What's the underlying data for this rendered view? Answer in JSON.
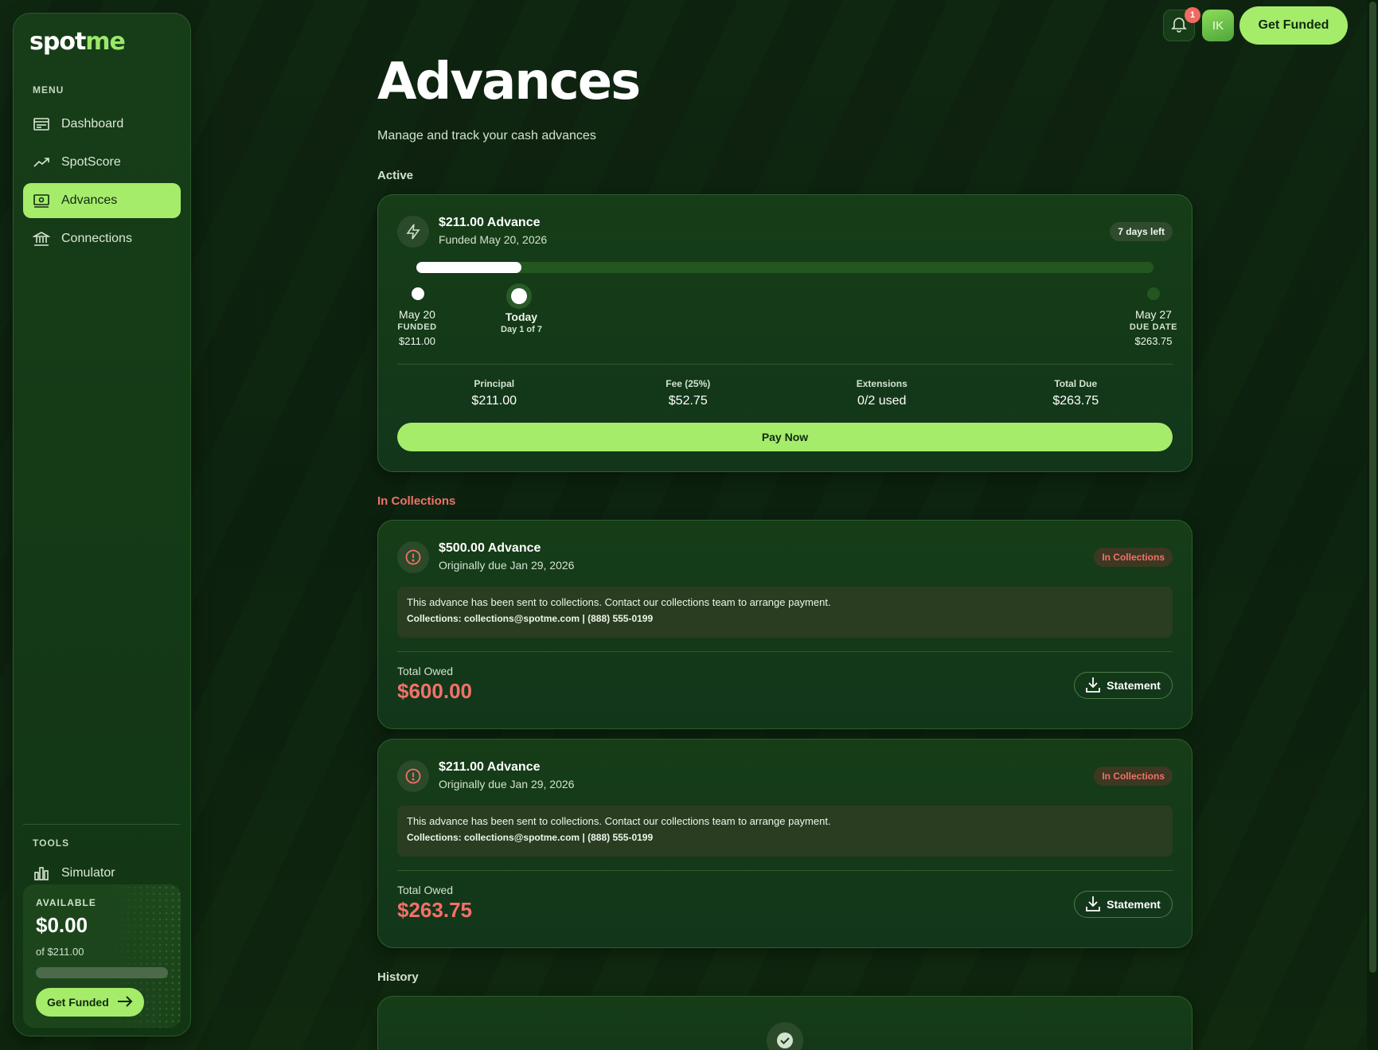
{
  "brand": {
    "logo_part1": "spot",
    "logo_part2": "me"
  },
  "sidebar": {
    "menu_label": "MENU",
    "items": [
      {
        "label": "Dashboard",
        "icon": "dashboard-icon"
      },
      {
        "label": "SpotScore",
        "icon": "trend-icon"
      },
      {
        "label": "Advances",
        "icon": "cash-icon",
        "active": true
      },
      {
        "label": "Connections",
        "icon": "bank-icon"
      }
    ],
    "tools_label": "TOOLS",
    "tools": [
      {
        "label": "Simulator",
        "icon": "bar-chart-icon"
      }
    ],
    "available": {
      "label": "AVAILABLE",
      "amount": "$0.00",
      "of_text": "of $211.00",
      "fraction_used": 0,
      "button": "Get Funded"
    }
  },
  "topbar": {
    "notification_count": "1",
    "avatar_initials": "IK",
    "cta": "Get Funded"
  },
  "page": {
    "title": "Advances",
    "subtitle": "Manage and track your cash advances"
  },
  "active": {
    "section_label": "Active",
    "title": "$211.00 Advance",
    "funded_text": "Funded May 20, 2026",
    "days_left": "7 days left",
    "progress_fraction": 0.143,
    "timeline": {
      "start": {
        "date": "May 20",
        "caption": "FUNDED",
        "amount": "$211.00"
      },
      "today": {
        "label": "Today",
        "day": "Day 1 of 7"
      },
      "end": {
        "date": "May 27",
        "caption": "DUE DATE",
        "amount": "$263.75"
      }
    },
    "stats": [
      {
        "label": "Principal",
        "value": "$211.00"
      },
      {
        "label": "Fee (25%)",
        "value": "$52.75"
      },
      {
        "label": "Extensions",
        "value": "0/2 used"
      },
      {
        "label": "Total Due",
        "value": "$263.75"
      }
    ],
    "pay_button": "Pay Now"
  },
  "collections": {
    "section_label": "In Collections",
    "items": [
      {
        "title": "$500.00 Advance",
        "due_text": "Originally due Jan 29, 2026",
        "status": "In Collections",
        "notice": "This advance has been sent to collections. Contact our collections team to arrange payment.",
        "contact": "Collections: collections@spotme.com | (888) 555-0199",
        "owed_label": "Total Owed",
        "owed_amount": "$600.00",
        "statement_button": "Statement"
      },
      {
        "title": "$211.00 Advance",
        "due_text": "Originally due Jan 29, 2026",
        "status": "In Collections",
        "notice": "This advance has been sent to collections. Contact our collections team to arrange payment.",
        "contact": "Collections: collections@spotme.com | (888) 555-0199",
        "owed_label": "Total Owed",
        "owed_amount": "$263.75",
        "statement_button": "Statement"
      }
    ]
  },
  "history": {
    "section_label": "History"
  },
  "colors": {
    "accent": "#a6ec6b",
    "danger": "#f2716a",
    "background": "#0e2310",
    "card": "#163d17"
  }
}
